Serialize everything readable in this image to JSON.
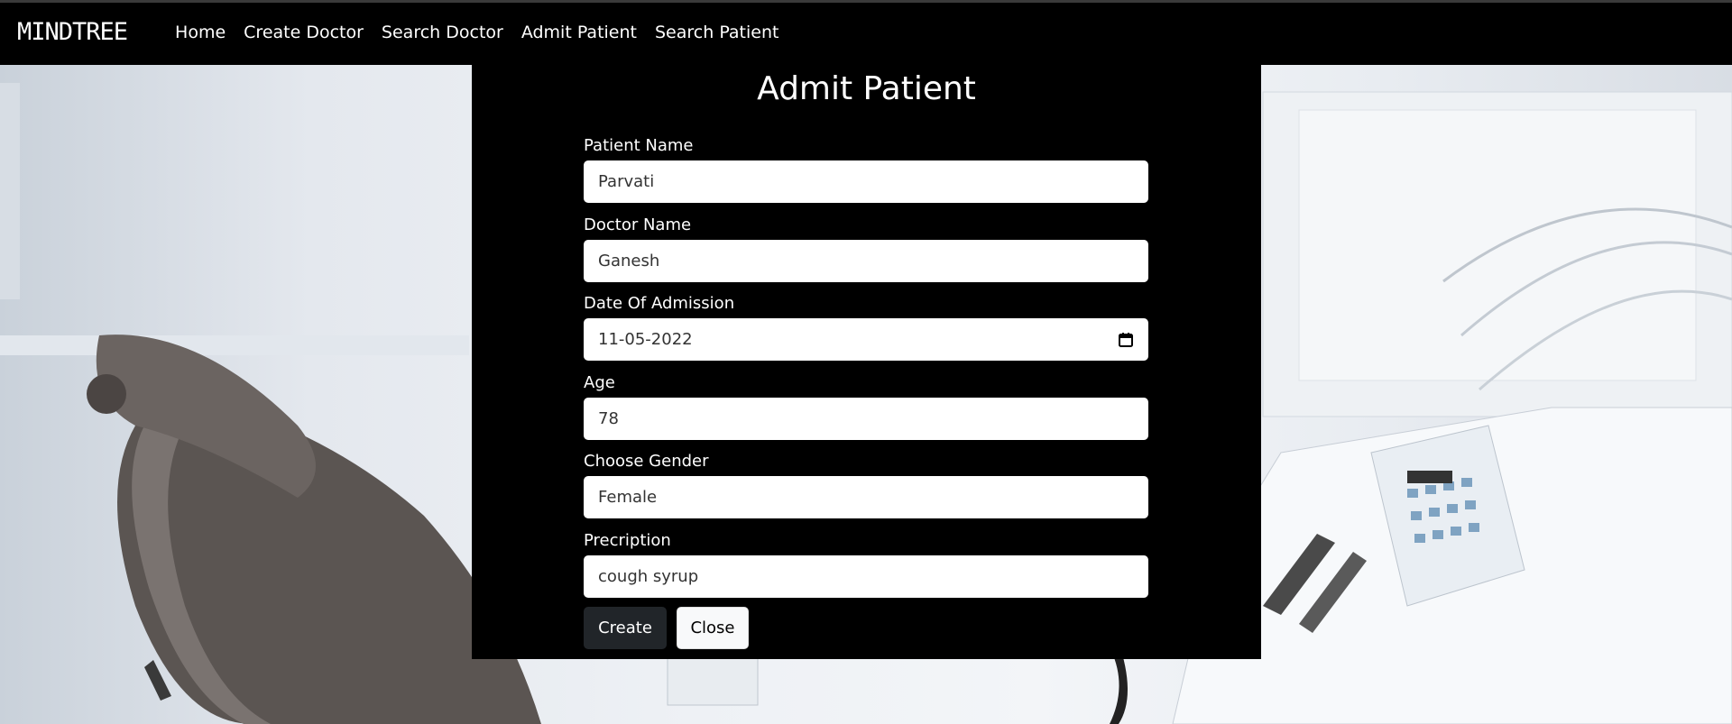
{
  "navbar": {
    "brand": "MINDTREE",
    "links": [
      "Home",
      "Create Doctor",
      "Search Doctor",
      "Admit Patient",
      "Search Patient"
    ]
  },
  "form": {
    "title": "Admit Patient",
    "fields": [
      {
        "label": "Patient Name",
        "value": "Parvati"
      },
      {
        "label": "Doctor Name",
        "value": "Ganesh"
      },
      {
        "label": "Date Of Admission",
        "value": "11-05-2022"
      },
      {
        "label": "Age",
        "value": "78"
      },
      {
        "label": "Choose Gender",
        "value": "Female"
      },
      {
        "label": "Precription",
        "value": "cough syrup"
      }
    ],
    "create_label": "Create",
    "close_label": "Close"
  },
  "icons": {
    "date_picker": "calendar-icon"
  }
}
